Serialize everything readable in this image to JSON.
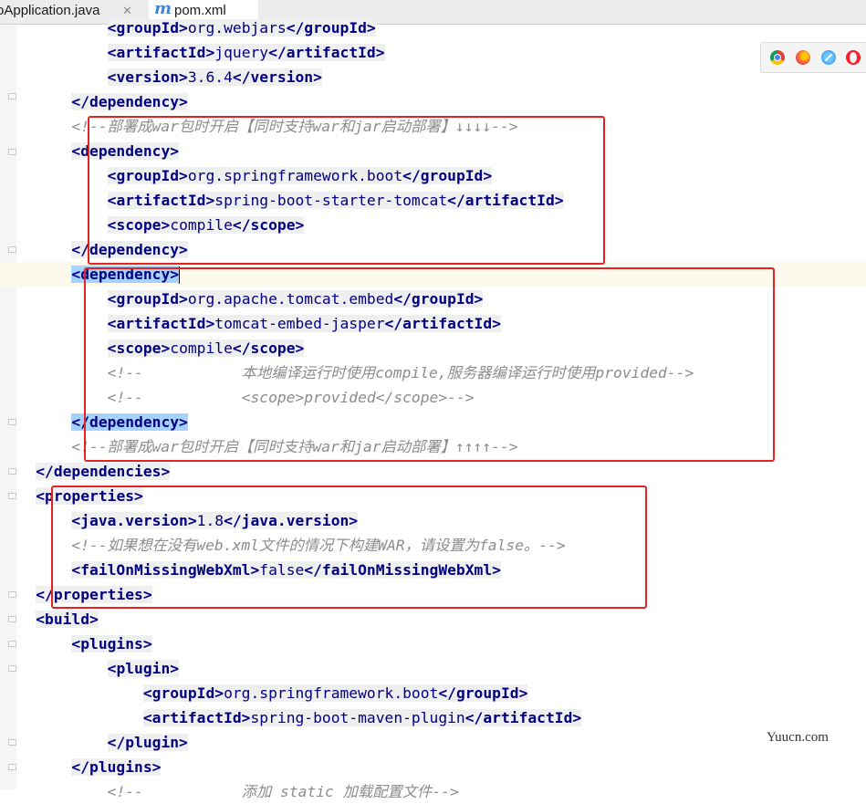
{
  "tabs": [
    {
      "label": "oApplication.java",
      "close": "✕"
    },
    {
      "label": "pom.xml",
      "icon_letter": "m"
    }
  ],
  "browser_icons": [
    "chrome-icon",
    "firefox-icon",
    "safari-icon",
    "opera-icon"
  ],
  "code": {
    "l0": {
      "open": "<groupId>",
      "text": "org.webjars",
      "close": "</groupId>"
    },
    "l1": {
      "open": "<artifactId>",
      "text": "jquery",
      "close": "</artifactId>"
    },
    "l2": {
      "open": "<version>",
      "text": "3.6.4",
      "close": "</version>"
    },
    "l3": {
      "close": "</dependency>"
    },
    "l4": {
      "comment": "<!--部署成war包时开启【同时支持war和jar启动部署】↓↓↓↓-->"
    },
    "l5": {
      "open": "<dependency>"
    },
    "l6": {
      "open": "<groupId>",
      "text": "org.springframework.boot",
      "close": "</groupId>"
    },
    "l7": {
      "open": "<artifactId>",
      "text": "spring-boot-starter-tomcat",
      "close": "</artifactId>"
    },
    "l8": {
      "open": "<scope>",
      "text": "compile",
      "close": "</scope>"
    },
    "l9": {
      "close": "</dependency>"
    },
    "l10": {
      "open": "<dependency>"
    },
    "l11": {
      "open": "<groupId>",
      "text": "org.apache.tomcat.embed",
      "close": "</groupId>"
    },
    "l12": {
      "open": "<artifactId>",
      "text": "tomcat-embed-jasper",
      "close": "</artifactId>"
    },
    "l13": {
      "open": "<scope>",
      "text": "compile",
      "close": "</scope>"
    },
    "l14": {
      "comment": "<!--           本地编译运行时使用compile,服务器编译运行时使用provided-->"
    },
    "l15": {
      "comment": "<!--           <scope>provided</scope>-->"
    },
    "l16": {
      "close": "</dependency>"
    },
    "l17": {
      "comment": "<!--部署成war包时开启【同时支持war和jar启动部署】↑↑↑↑-->"
    },
    "l18": {
      "close": "</dependencies>"
    },
    "l19": {
      "open": "<properties>"
    },
    "l20": {
      "open": "<java.version>",
      "text": "1.8",
      "close": "</java.version>"
    },
    "l21": {
      "comment": "<!--如果想在没有web.xml文件的情况下构建WAR，请设置为false。-->"
    },
    "l22": {
      "open": "<failOnMissingWebXml>",
      "text": "false",
      "close": "</failOnMissingWebXml>"
    },
    "l23": {
      "close": "</properties>"
    },
    "l24": {
      "open": "<build>"
    },
    "l25": {
      "open": "<plugins>"
    },
    "l26": {
      "open": "<plugin>"
    },
    "l27": {
      "open": "<groupId>",
      "text": "org.springframework.boot",
      "close": "</groupId>"
    },
    "l28": {
      "open": "<artifactId>",
      "text": "spring-boot-maven-plugin",
      "close": "</artifactId>"
    },
    "l29": {
      "close": "</plugin>"
    },
    "l30": {
      "close": "</plugins>"
    },
    "l31": {
      "comment": "<!--           添加 static 加载配置文件-->"
    }
  },
  "watermark": "Yuucn.com"
}
